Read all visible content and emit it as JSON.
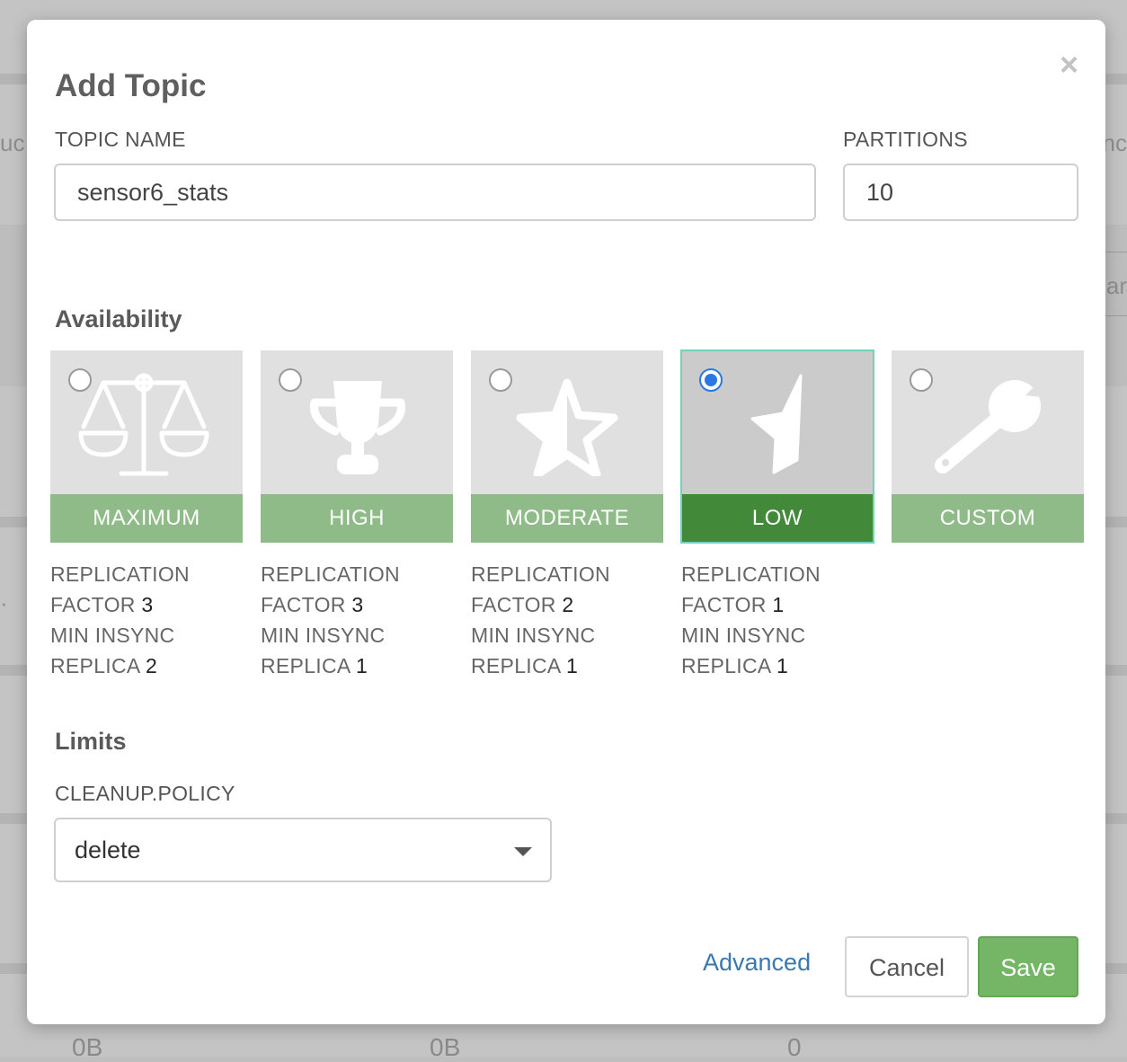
{
  "background": {
    "edge_left_1": "uc",
    "edge_right_1": "nc",
    "edge_right_2": "ar",
    "edge_left_2": "·",
    "bottom_values": [
      "0B",
      "0B",
      "0"
    ]
  },
  "modal": {
    "title": "Add Topic",
    "close_glyph": "×"
  },
  "form": {
    "topic_name": {
      "label": "TOPIC NAME",
      "value": "sensor6_stats"
    },
    "partitions": {
      "label": "PARTITIONS",
      "value": "10"
    }
  },
  "availability": {
    "title": "Availability",
    "selected": "LOW",
    "options": [
      {
        "label": "MAXIMUM",
        "icon": "scale-icon",
        "spec": {
          "line1": "REPLICATION",
          "rf_label": "FACTOR ",
          "rf_value": "3",
          "line3": "MIN INSYNC",
          "mir_label": "REPLICA ",
          "mir_value": "2"
        }
      },
      {
        "label": "HIGH",
        "icon": "trophy-icon",
        "spec": {
          "line1": "REPLICATION",
          "rf_label": "FACTOR ",
          "rf_value": "3",
          "line3": "MIN INSYNC",
          "mir_label": "REPLICA ",
          "mir_value": "1"
        }
      },
      {
        "label": "MODERATE",
        "icon": "half-star-icon",
        "spec": {
          "line1": "REPLICATION",
          "rf_label": "FACTOR ",
          "rf_value": "2",
          "line3": "MIN INSYNC",
          "mir_label": "REPLICA ",
          "mir_value": "1"
        }
      },
      {
        "label": "LOW",
        "icon": "quarter-star-icon",
        "spec": {
          "line1": "REPLICATION",
          "rf_label": "FACTOR ",
          "rf_value": "1",
          "line3": "MIN INSYNC",
          "mir_label": "REPLICA ",
          "mir_value": "1"
        }
      },
      {
        "label": "CUSTOM",
        "icon": "wrench-icon"
      }
    ]
  },
  "limits": {
    "title": "Limits",
    "cleanup_policy": {
      "label": "CLEANUP.POLICY",
      "value": "delete"
    }
  },
  "footer": {
    "advanced_label": "Advanced",
    "cancel_label": "Cancel",
    "save_label": "Save"
  },
  "colors": {
    "option_label_bg": "#8fbb88",
    "selected_label_bg": "#428a3a",
    "selected_border": "#71d3bd",
    "radio_checked": "#2b78e4",
    "save_bg": "#74b566",
    "link": "#3a78b0"
  }
}
